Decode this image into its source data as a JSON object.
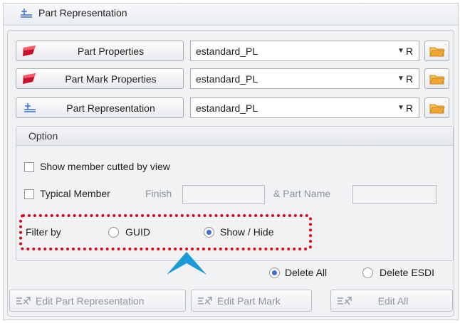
{
  "title": "Part Representation",
  "rows": [
    {
      "button_label": "Part Properties",
      "icon": "red-part-icon",
      "value": "estandard_PL",
      "suffix": "R"
    },
    {
      "button_label": "Part Mark Properties",
      "icon": "red-part-icon",
      "value": "estandard_PL",
      "suffix": "R"
    },
    {
      "button_label": "Part Representation",
      "icon": "part-representation-icon",
      "value": "estandard_PL",
      "suffix": "R"
    }
  ],
  "option": {
    "title": "Option",
    "show_member_cutted": "Show member cutted by view",
    "typical_member": "Typical Member",
    "finish_label": "Finish",
    "part_name_label": "& Part Name",
    "filter_by": "Filter by",
    "filter_options": [
      {
        "label": "GUID",
        "selected": false
      },
      {
        "label": "Show / Hide",
        "selected": true
      }
    ]
  },
  "delete_options": [
    {
      "label": "Delete All",
      "selected": true
    },
    {
      "label": "Delete ESDI",
      "selected": false
    }
  ],
  "bottom_buttons": {
    "edit_part_representation": "Edit Part Representation",
    "edit_part_mark": "Edit Part Mark",
    "edit_all": "Edit All"
  },
  "colors": {
    "highlight_dotted": "#e0001b",
    "pointer_arrow": "#1a9ad6",
    "radio_selected": "#3b6fd4",
    "folder_icon": "#f0a532"
  }
}
